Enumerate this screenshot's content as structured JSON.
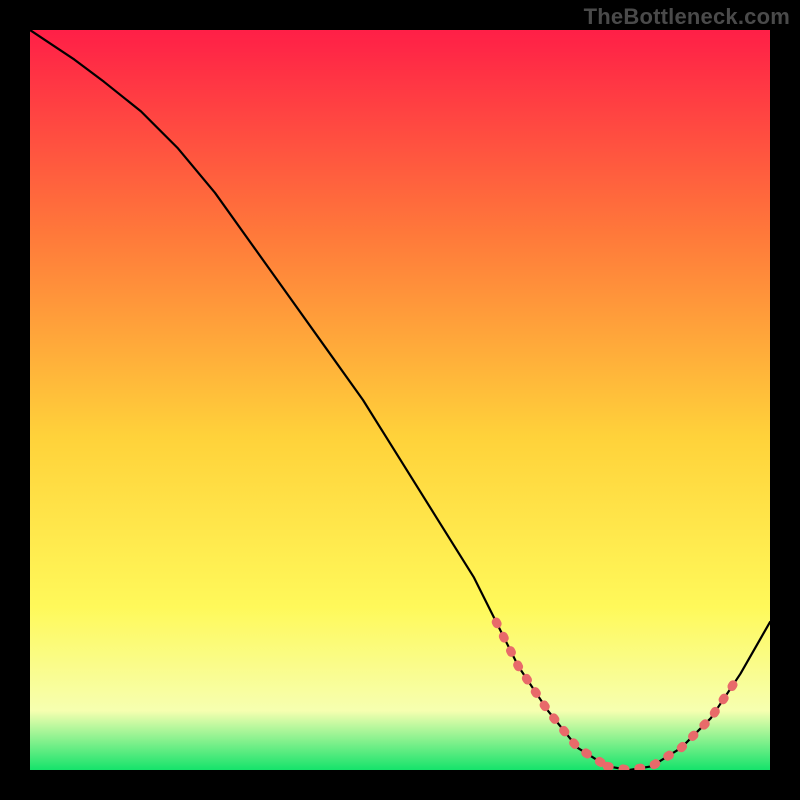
{
  "watermark": "TheBottleneck.com",
  "colors": {
    "background": "#000000",
    "curve": "#000000",
    "highlight": "#e86a6a",
    "gradient_top": "#ff1f47",
    "gradient_mid_upper": "#ff7a3a",
    "gradient_mid": "#ffd23a",
    "gradient_mid_lower": "#fff95a",
    "gradient_low": "#f6ffb0",
    "gradient_bottom": "#15e36b"
  },
  "chart_data": {
    "type": "line",
    "title": "",
    "xlabel": "",
    "ylabel": "",
    "xlim": [
      0,
      100
    ],
    "ylim": [
      0,
      100
    ],
    "x": [
      0,
      3,
      6,
      10,
      15,
      20,
      25,
      30,
      35,
      40,
      45,
      50,
      55,
      60,
      63,
      66,
      70,
      74,
      78,
      81,
      84,
      88,
      92,
      96,
      100
    ],
    "values": [
      100,
      98,
      96,
      93,
      89,
      84,
      78,
      71,
      64,
      57,
      50,
      42,
      34,
      26,
      20,
      14,
      8,
      3,
      0.5,
      0,
      0.5,
      3,
      7,
      13,
      20
    ],
    "highlight_segments": [
      {
        "x": [
          63,
          66,
          70,
          74,
          78
        ],
        "y": [
          20,
          14,
          8,
          3,
          0.5
        ]
      },
      {
        "x": [
          78,
          81,
          84,
          88
        ],
        "y": [
          0.5,
          0,
          0.5,
          3
        ]
      },
      {
        "x": [
          88,
          92,
          96
        ],
        "y": [
          3,
          7,
          13
        ]
      }
    ],
    "annotations": []
  }
}
